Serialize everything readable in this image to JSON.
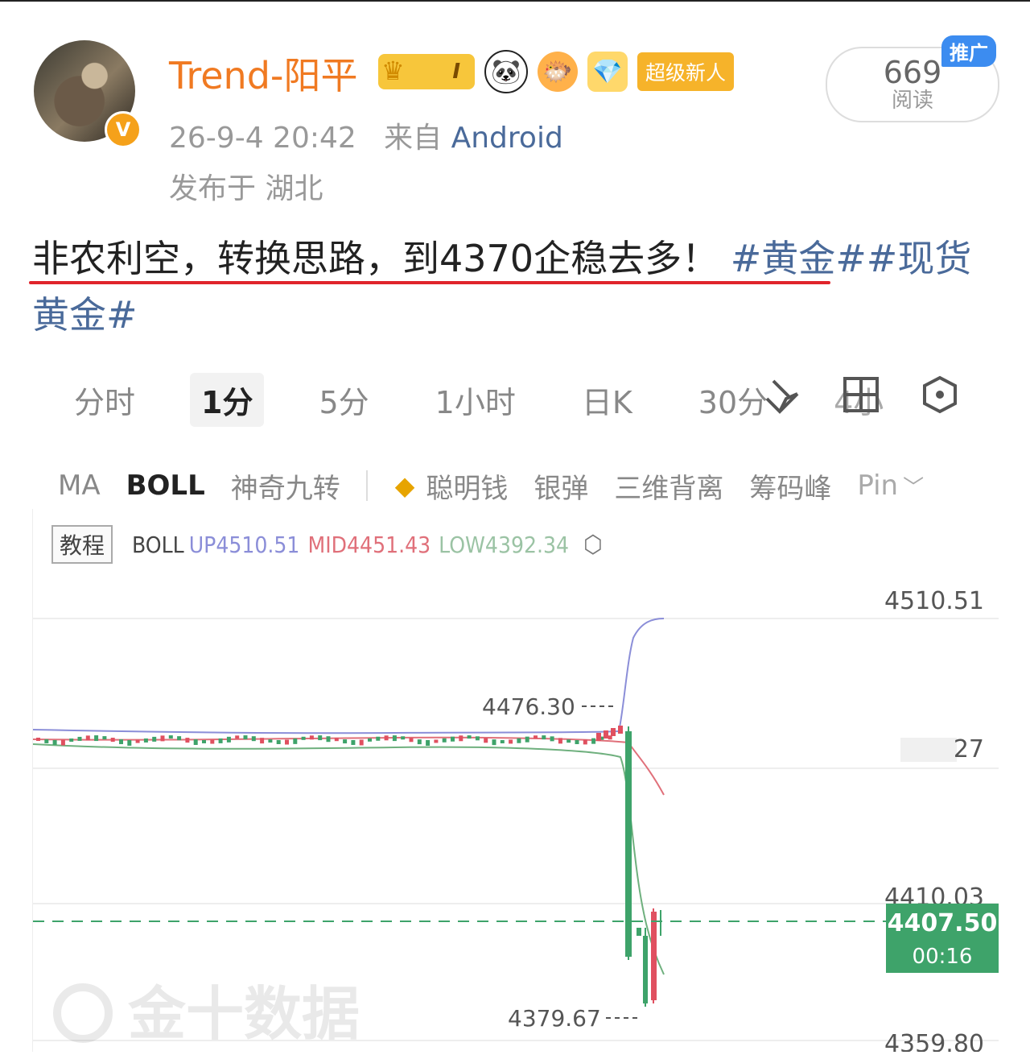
{
  "post": {
    "username": "Trend-阳平",
    "badges": {
      "crown_level": "I",
      "newbie_label": "超级新人"
    },
    "avatar_badge": "V",
    "time": "26-9-4 20:42",
    "from_label": "来自",
    "source": "Android",
    "location": "发布于 湖北",
    "read_count": "669",
    "read_label": "阅读",
    "promo_label": "推广",
    "text": "非农利空，转换思路，到4370企稳去多！",
    "tag1": "#黄金#",
    "tag2": "#现货黄金#"
  },
  "chart_toolbar": {
    "tabs": [
      "分时",
      "1分",
      "5分",
      "1小时",
      "日K",
      "30分",
      "4小"
    ],
    "active_tab": "1分"
  },
  "indicators": {
    "items": [
      "MA",
      "BOLL",
      "神奇九转"
    ],
    "active": "BOLL",
    "premium": [
      "聪明钱",
      "银弹",
      "三维背离",
      "筹码峰",
      "Pin"
    ]
  },
  "legend": {
    "tutorial": "教程",
    "name": "BOLL",
    "up": "UP4510.51",
    "mid": "MID4451.43",
    "low": "LOW4392.34"
  },
  "chart_data": {
    "type": "line",
    "indicator": "BOLL",
    "price_axis": [
      "4510.51",
      "27",
      "4410.03",
      "4359.80"
    ],
    "annotations": [
      "4476.30",
      "4379.67"
    ],
    "current_price": "4407.50",
    "countdown": "00:16",
    "watermark": "金十数据",
    "series": [
      {
        "name": "UP",
        "color": "#8b8ed8"
      },
      {
        "name": "MID",
        "color": "#e0707a"
      },
      {
        "name": "LOW",
        "color": "#9bc3a4"
      }
    ]
  }
}
